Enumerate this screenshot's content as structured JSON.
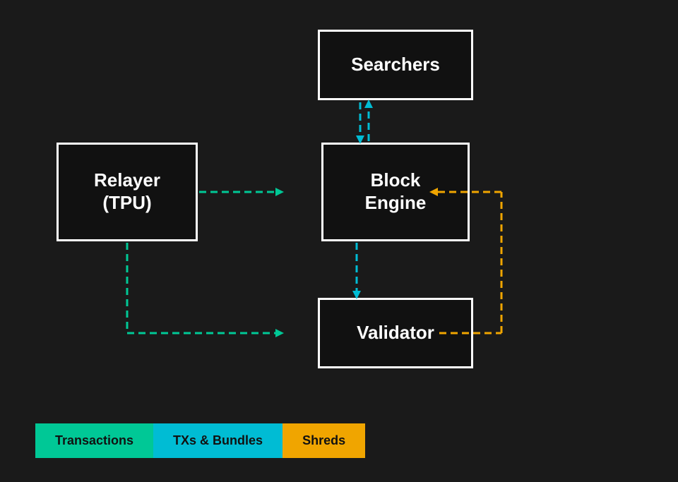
{
  "boxes": {
    "searchers": {
      "label": "Searchers"
    },
    "relayer": {
      "label": "Relayer\n(TPU)"
    },
    "block_engine": {
      "label": "Block\nEngine"
    },
    "validator": {
      "label": "Validator"
    }
  },
  "legend": {
    "transactions": {
      "label": "Transactions"
    },
    "bundles": {
      "label": "TXs & Bundles"
    },
    "shreds": {
      "label": "Shreds"
    }
  },
  "colors": {
    "teal": "#00c896",
    "cyan": "#00bcd4",
    "orange": "#f0a500",
    "white": "#ffffff",
    "bg": "#1a1a1a"
  }
}
